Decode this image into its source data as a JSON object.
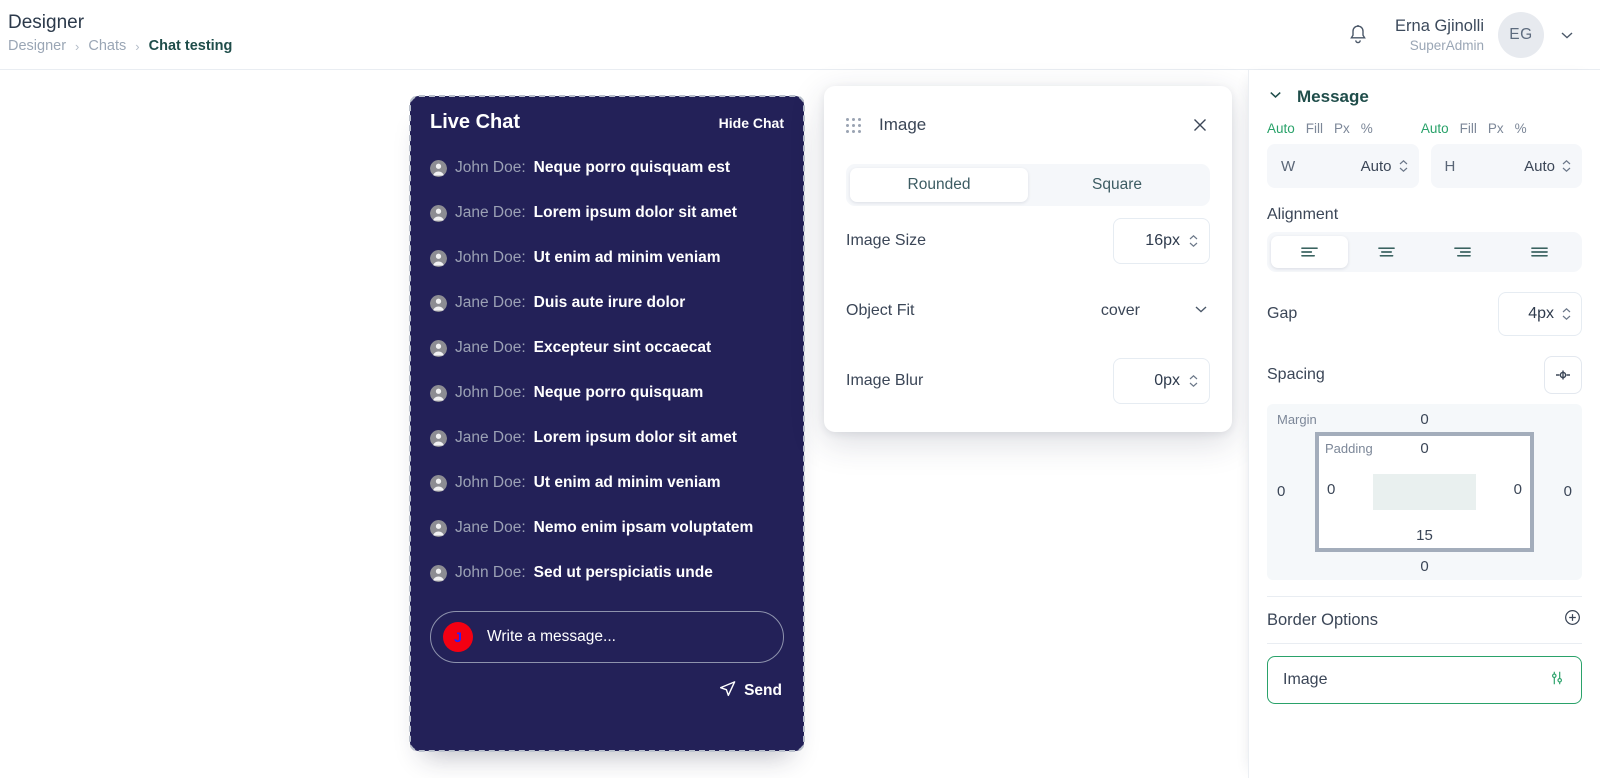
{
  "header": {
    "page_title": "Designer",
    "breadcrumb": [
      {
        "label": "Designer",
        "active": false
      },
      {
        "label": "Chats",
        "active": false
      },
      {
        "label": "Chat testing",
        "active": true
      }
    ],
    "separator": "›",
    "bell_icon": "bell-icon",
    "user": {
      "name": "Erna Gjinolli",
      "role": "SuperAdmin",
      "initials": "EG",
      "chevron_icon": "chevron-down-icon"
    }
  },
  "chat_widget": {
    "title": "Live Chat",
    "hide_label": "Hide Chat",
    "background": "#232158",
    "messages": [
      {
        "author": "John Doe:",
        "text": "Neque porro quisquam est"
      },
      {
        "author": "Jane Doe:",
        "text": "Lorem ipsum dolor sit amet"
      },
      {
        "author": "John Doe:",
        "text": "Ut enim ad minim veniam"
      },
      {
        "author": "Jane Doe:",
        "text": "Duis aute irure dolor"
      },
      {
        "author": "Jane Doe:",
        "text": "Excepteur sint occaecat"
      },
      {
        "author": "John Doe:",
        "text": "Neque porro quisquam"
      },
      {
        "author": "Jane Doe:",
        "text": "Lorem ipsum dolor sit amet"
      },
      {
        "author": "John Doe:",
        "text": "Ut enim ad minim veniam"
      },
      {
        "author": "Jane Doe:",
        "text": "Nemo enim ipsam voluptatem"
      },
      {
        "author": "John Doe:",
        "text": "Sed ut perspiciatis unde"
      }
    ],
    "input": {
      "placeholder": "Write a message...",
      "avatar_initial": "J",
      "avatar_color": "#f40012"
    },
    "send_label": "Send",
    "send_icon": "send-icon"
  },
  "modal": {
    "title": "Image",
    "drag_icon": "drag-handle-icon",
    "close_icon": "close-icon",
    "shape_tabs": [
      {
        "label": "Rounded",
        "active": true
      },
      {
        "label": "Square",
        "active": false
      }
    ],
    "controls": [
      {
        "label": "Image Size",
        "value": "16px",
        "type": "number"
      },
      {
        "label": "Object Fit",
        "value": "cover",
        "type": "select"
      },
      {
        "label": "Image Blur",
        "value": "0px",
        "type": "number"
      }
    ]
  },
  "right_panel": {
    "section": {
      "title": "Message",
      "collapse_icon": "chevron-down-icon"
    },
    "size": {
      "width": {
        "units": [
          "Auto",
          "Fill",
          "Px",
          "%"
        ],
        "active_unit": "Auto",
        "key": "W",
        "value": "Auto"
      },
      "height": {
        "units": [
          "Auto",
          "Fill",
          "Px",
          "%"
        ],
        "active_unit": "Auto",
        "key": "H",
        "value": "Auto"
      }
    },
    "alignment": {
      "label": "Alignment",
      "options": [
        "align-left-icon",
        "align-center-icon",
        "align-right-icon",
        "align-justify-icon"
      ],
      "active_index": 0
    },
    "gap": {
      "label": "Gap",
      "value": "4px"
    },
    "spacing": {
      "label": "Spacing",
      "reset_icon": "spacing-link-icon",
      "margin_label": "Margin",
      "padding_label": "Padding",
      "margin": {
        "top": "0",
        "right": "0",
        "bottom": "0",
        "left": "0"
      },
      "padding": {
        "top": "0",
        "right": "0",
        "bottom": "15",
        "left": "0"
      }
    },
    "border_options": {
      "label": "Border Options",
      "add_icon": "plus-circle-icon"
    },
    "image_field": {
      "label": "Image",
      "icon": "sliders-icon",
      "accent": "#2aa26a"
    }
  }
}
